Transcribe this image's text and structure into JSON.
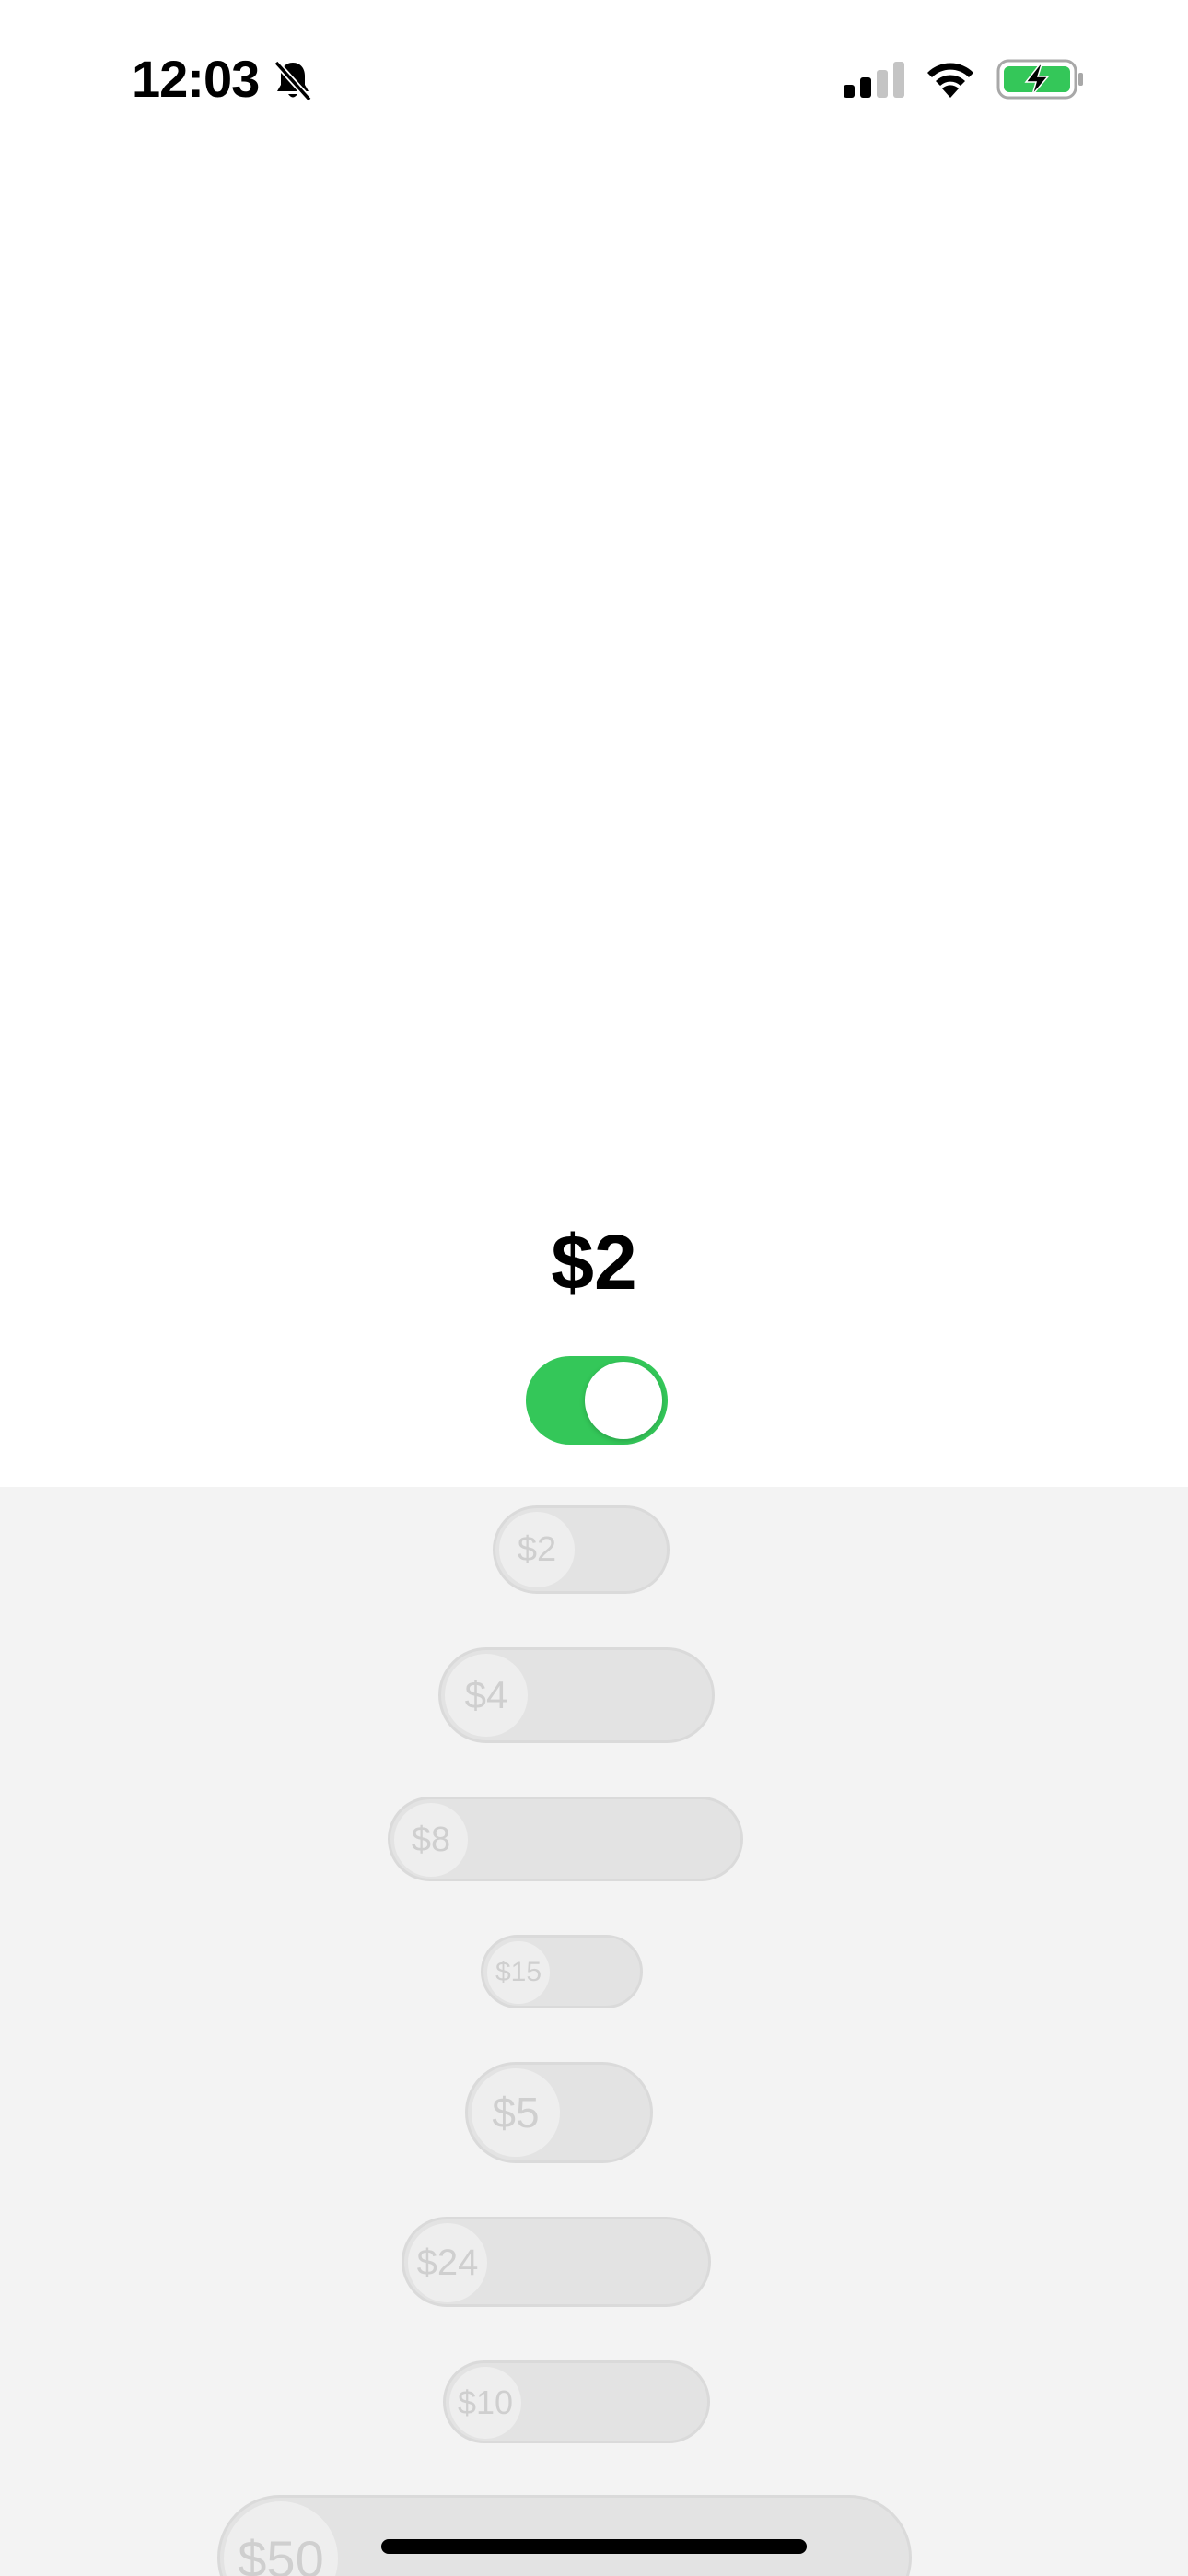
{
  "status_bar": {
    "time": "12:03",
    "icons": [
      "bell-slash-icon",
      "cellular-signal-icon",
      "wifi-icon",
      "battery-charging-icon"
    ],
    "battery_color": "#34c759"
  },
  "main": {
    "amount": "$2",
    "toggle_on": true,
    "toggle_color": "#34c759"
  },
  "list": {
    "items": [
      {
        "label": "$2"
      },
      {
        "label": "$4"
      },
      {
        "label": "$8"
      },
      {
        "label": "$15"
      },
      {
        "label": "$5"
      },
      {
        "label": "$24"
      },
      {
        "label": "$10"
      },
      {
        "label": "$50"
      }
    ]
  }
}
